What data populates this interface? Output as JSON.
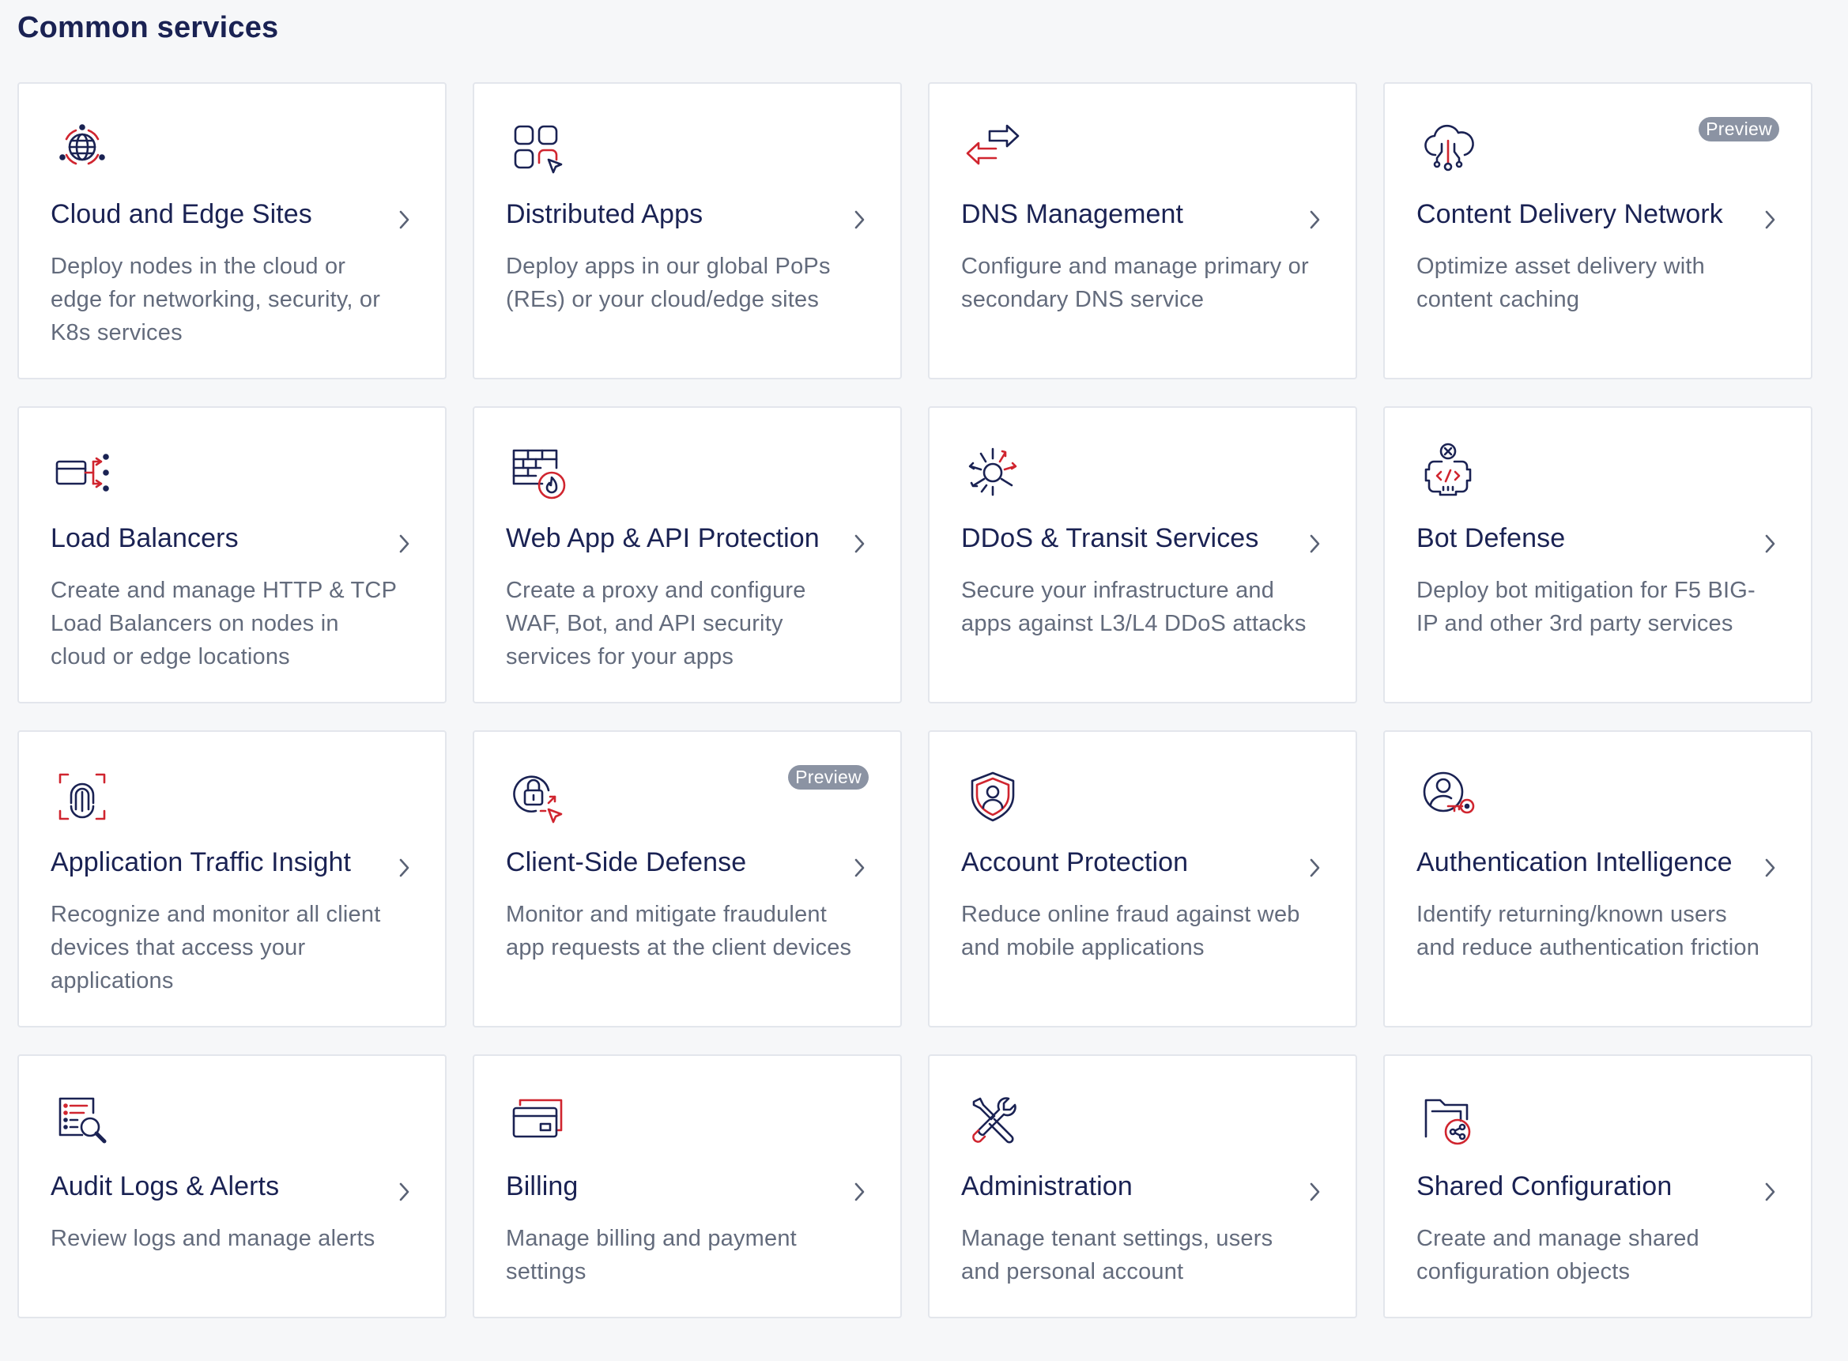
{
  "page": {
    "title": "Common services"
  },
  "colors": {
    "navy": "#1a2253",
    "red": "#d0252f",
    "description": "#636b7c",
    "badge": "#8b93a3",
    "card_border": "#e3e6ec",
    "background": "#f6f7f9"
  },
  "cards": [
    {
      "icon": "globe-network-icon",
      "title": "Cloud and Edge Sites",
      "description": "Deploy nodes in the cloud or edge for networking, security, or K8s services",
      "badge": ""
    },
    {
      "icon": "distributed-apps-icon",
      "title": "Distributed Apps",
      "description": "Deploy apps in our global PoPs (REs) or your cloud/edge sites",
      "badge": ""
    },
    {
      "icon": "dns-arrows-icon",
      "title": "DNS Management",
      "description": "Configure and manage primary or secondary DNS service",
      "badge": ""
    },
    {
      "icon": "cloud-cdn-icon",
      "title": "Content Delivery Network",
      "description": "Optimize asset delivery with content caching",
      "badge": "Preview"
    },
    {
      "icon": "load-balancer-icon",
      "title": "Load Balancers",
      "description": "Create and manage HTTP & TCP Load Balancers on nodes in cloud or edge locations",
      "badge": ""
    },
    {
      "icon": "firewall-icon",
      "title": "Web App & API Protection",
      "description": "Create a proxy and configure WAF, Bot, and API security services for your apps",
      "badge": ""
    },
    {
      "icon": "ddos-burst-icon",
      "title": "DDoS & Transit Services",
      "description": "Secure your infrastructure and apps against L3/L4 DDoS attacks",
      "badge": ""
    },
    {
      "icon": "bot-icon",
      "title": "Bot Defense",
      "description": "Deploy bot mitigation for F5 BIG-IP and other 3rd party services",
      "badge": ""
    },
    {
      "icon": "fingerprint-icon",
      "title": "Application Traffic Insight",
      "description": "Recognize and monitor all client devices that access your applications",
      "badge": ""
    },
    {
      "icon": "client-lock-icon",
      "title": "Client-Side Defense",
      "description": "Monitor and mitigate fraudulent app requests at the client devices",
      "badge": "Preview"
    },
    {
      "icon": "shield-user-icon",
      "title": "Account Protection",
      "description": "Reduce online fraud against web and mobile applications",
      "badge": ""
    },
    {
      "icon": "user-key-icon",
      "title": "Authentication Intelligence",
      "description": "Identify returning/known users and reduce authentication friction",
      "badge": ""
    },
    {
      "icon": "audit-search-icon",
      "title": "Audit Logs & Alerts",
      "description": "Review logs and manage alerts",
      "badge": ""
    },
    {
      "icon": "credit-card-icon",
      "title": "Billing",
      "description": "Manage billing and payment settings",
      "badge": ""
    },
    {
      "icon": "tools-icon",
      "title": "Administration",
      "description": "Manage tenant settings, users and personal account",
      "badge": ""
    },
    {
      "icon": "shared-folder-icon",
      "title": "Shared Configuration",
      "description": "Create and manage shared configuration objects",
      "badge": ""
    }
  ]
}
